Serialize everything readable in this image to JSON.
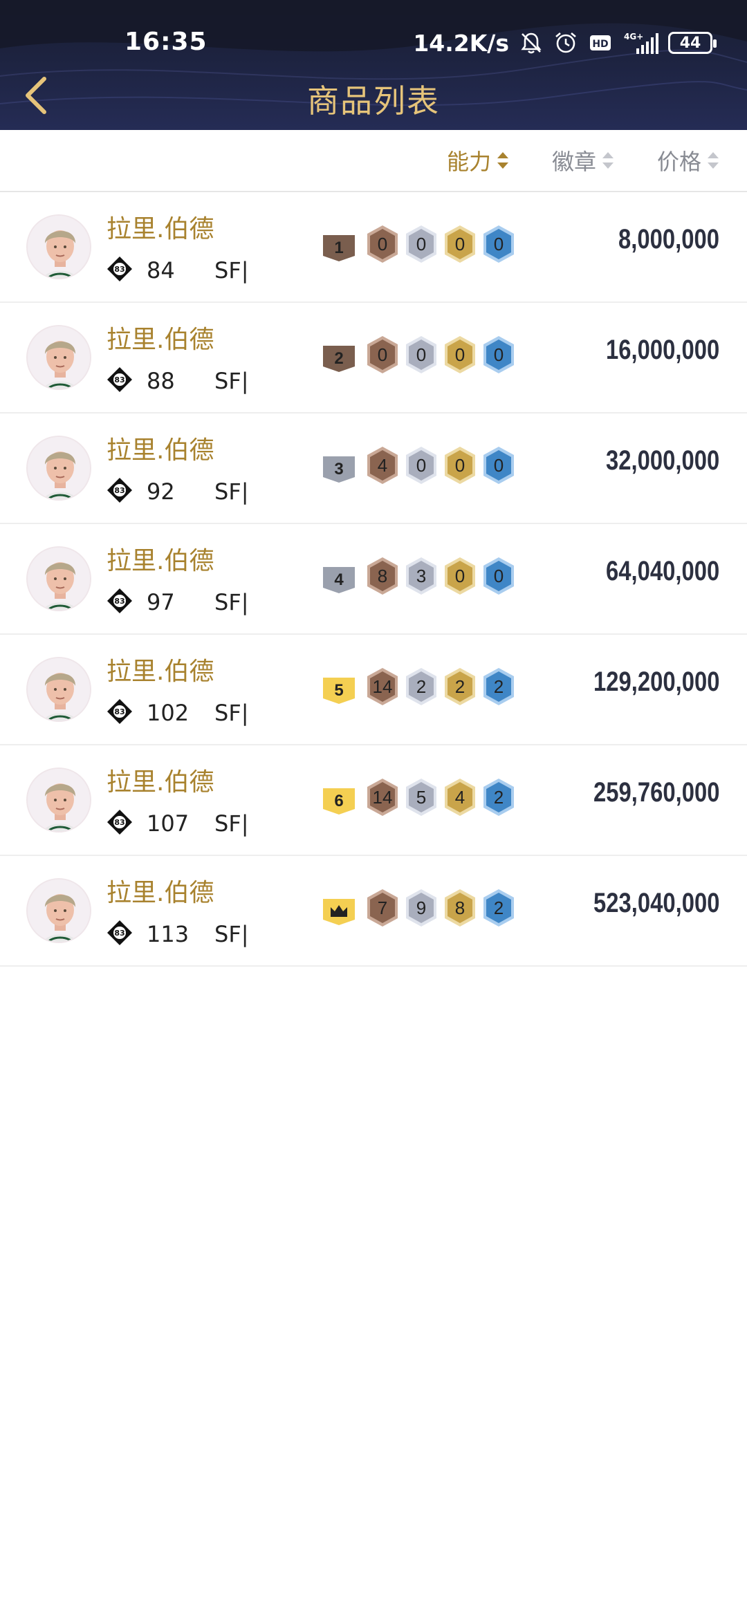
{
  "status_bar": {
    "time": "16:35",
    "net_speed": "14.2K/s",
    "network": "4G+",
    "battery": "44"
  },
  "header": {
    "title": "商品列表"
  },
  "sort_bar": {
    "options": [
      {
        "label": "能力",
        "active": true
      },
      {
        "label": "徽章",
        "active": false
      },
      {
        "label": "价格",
        "active": false
      }
    ]
  },
  "items": [
    {
      "name": "拉里.伯德",
      "rating": "84",
      "position": "SF|",
      "tier": "1",
      "badges": [
        "0",
        "0",
        "0",
        "0"
      ],
      "price": "8,000,000"
    },
    {
      "name": "拉里.伯德",
      "rating": "88",
      "position": "SF|",
      "tier": "2",
      "badges": [
        "0",
        "0",
        "0",
        "0"
      ],
      "price": "16,000,000"
    },
    {
      "name": "拉里.伯德",
      "rating": "92",
      "position": "SF|",
      "tier": "3",
      "badges": [
        "4",
        "0",
        "0",
        "0"
      ],
      "price": "32,000,000"
    },
    {
      "name": "拉里.伯德",
      "rating": "97",
      "position": "SF|",
      "tier": "4",
      "badges": [
        "8",
        "3",
        "0",
        "0"
      ],
      "price": "64,040,000"
    },
    {
      "name": "拉里.伯德",
      "rating": "102",
      "position": "SF|",
      "tier": "5",
      "badges": [
        "14",
        "2",
        "2",
        "2"
      ],
      "price": "129,200,000"
    },
    {
      "name": "拉里.伯德",
      "rating": "107",
      "position": "SF|",
      "tier": "6",
      "badges": [
        "14",
        "5",
        "4",
        "2"
      ],
      "price": "259,760,000"
    },
    {
      "name": "拉里.伯德",
      "rating": "113",
      "position": "SF|",
      "tier": "crown",
      "badges": [
        "7",
        "9",
        "8",
        "2"
      ],
      "price": "523,040,000"
    }
  ],
  "colors": {
    "accent_gold": "#a8822e",
    "title_gold": "#e6c47a",
    "price": "#2c3040",
    "badge_bronze": "#8a6450",
    "badge_silver": "#a9aebd",
    "badge_gold": "#c9a44a",
    "badge_blue": "#3f86c6"
  }
}
